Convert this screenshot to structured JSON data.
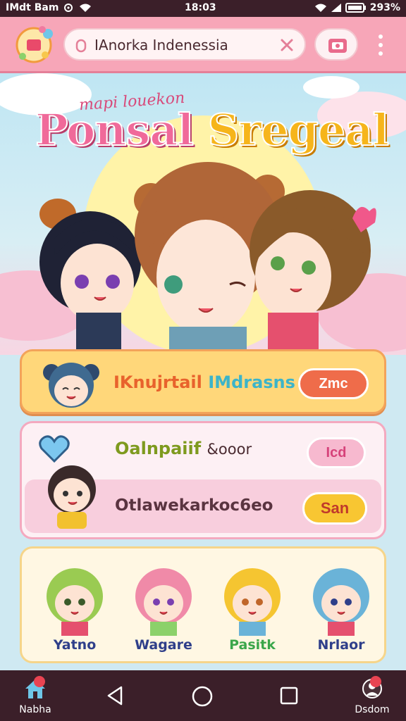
{
  "status_bar": {
    "carrier": "IMdt Bam",
    "time": "18:03",
    "battery": "293%"
  },
  "browser": {
    "url_value": "IAnorka Indenessia"
  },
  "hero": {
    "subtitle": "mapi louekon",
    "title_part1": "Ponsal",
    "title_part2": "Sregeal"
  },
  "card1": {
    "title_part1": "IKnujrtail",
    "title_part2": "IMdrasns",
    "button": "Zmc"
  },
  "card2": {
    "row1_part1": "Oalnpaiif",
    "row1_part2": "&ooor",
    "row1_button": "Icd",
    "row2_text": "Otlawekarkoc6eo",
    "row2_button": "San"
  },
  "characters": [
    {
      "name": "Yatno",
      "color": "#2f3f8a",
      "hair": "#9acb52"
    },
    {
      "name": "Wagare",
      "color": "#2f3f8a",
      "hair": "#f08aa8"
    },
    {
      "name": "Pasitk",
      "color": "#3aa64a",
      "hair": "#f5c531"
    },
    {
      "name": "Nrlaor",
      "color": "#2f3f8a",
      "hair": "#6ab3d8"
    }
  ],
  "navbar": {
    "home_label": "Nabha",
    "right_label": "Dsdom"
  },
  "colors": {
    "toolbar": "#f7a6b8",
    "statusbar": "#3b1f29",
    "accent": "#f06a9a"
  }
}
